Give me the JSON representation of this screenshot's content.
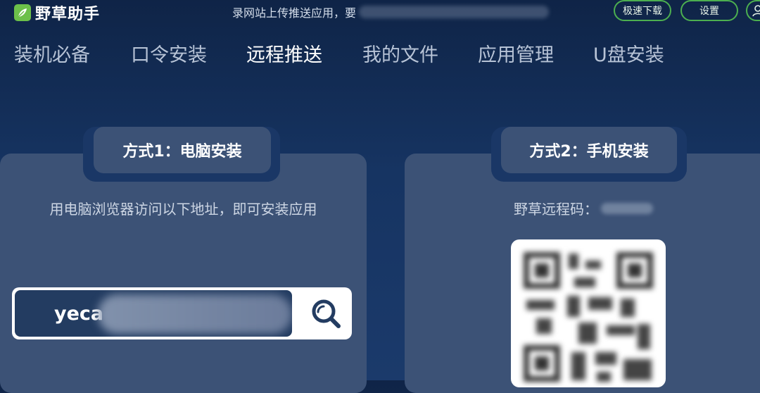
{
  "app": {
    "name": "野草助手"
  },
  "topbar": {
    "notice": "录网站上传推送应用，要",
    "fast_download": "极速下载",
    "settings": "设置"
  },
  "nav": {
    "items": [
      {
        "label": "装机必备"
      },
      {
        "label": "口令安装"
      },
      {
        "label": "远程推送",
        "active": true
      },
      {
        "label": "我的文件"
      },
      {
        "label": "应用管理"
      },
      {
        "label": "U盘安装"
      }
    ]
  },
  "method1": {
    "title": "方式1：电脑安装",
    "description": "用电脑浏览器访问以下地址，即可安装应用",
    "url_visible": "yeca"
  },
  "method2": {
    "title": "方式2：手机安装",
    "code_label": "野草远程码："
  },
  "colors": {
    "accent_green": "#4caf50",
    "background": "#163462",
    "card": "#3c5276"
  }
}
